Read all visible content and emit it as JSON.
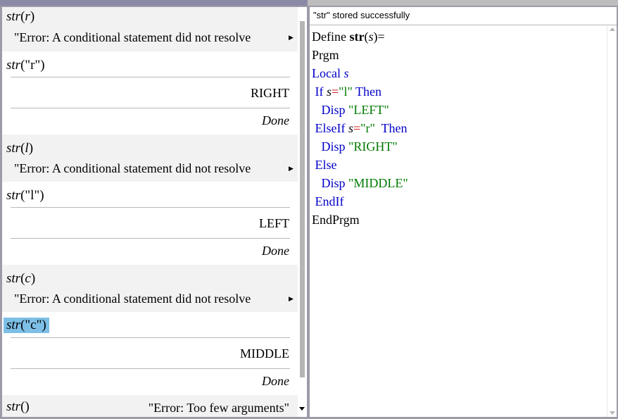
{
  "calculator": {
    "entries": [
      {
        "fn": "str",
        "arg": "r",
        "result": "\"Error: A conditional statement did not resolve"
      },
      {
        "fn": "str",
        "arg": "\"r\"",
        "output": "RIGHT",
        "result": "Done"
      },
      {
        "fn": "str",
        "arg": "l",
        "result": "\"Error: A conditional statement did not resolve"
      },
      {
        "fn": "str",
        "arg": "\"l\"",
        "output": "LEFT",
        "result": "Done"
      },
      {
        "fn": "str",
        "arg": "c",
        "result": "\"Error: A conditional statement did not resolve"
      },
      {
        "fn": "str",
        "arg": "\"c\"",
        "output": "MIDDLE",
        "result": "Done"
      },
      {
        "fn": "str",
        "arg": "",
        "result": "\"Error: Too few arguments\""
      }
    ]
  },
  "editor": {
    "status": "\"str\" stored successfully",
    "lines": {
      "define_kw": "Define ",
      "define_name": "str",
      "define_param": "s",
      "define_eq": "=",
      "prgm": "Prgm",
      "local_kw": "Local ",
      "local_var": "s",
      "if_kw": "If ",
      "if_var": "s",
      "if_eq": "=",
      "if_str": "\"l\"",
      "then1": " Then",
      "disp1_kw": "Disp ",
      "disp1_str": "\"LEFT\"",
      "elseif_kw": "ElseIf ",
      "elseif_var": "s",
      "elseif_eq": "=",
      "elseif_str": "\"r\"",
      "then2": "  Then",
      "disp2_kw": "Disp ",
      "disp2_str": "\"RIGHT\"",
      "else_kw": "Else",
      "disp3_kw": "Disp ",
      "disp3_str": "\"MIDDLE\"",
      "endif_kw": "EndIf",
      "endprgm": "EndPrgm"
    }
  },
  "colors": {
    "keyword": "#0000c8",
    "string": "#007a00",
    "operator": "#cc0000",
    "selection": "#7dbfe6"
  }
}
